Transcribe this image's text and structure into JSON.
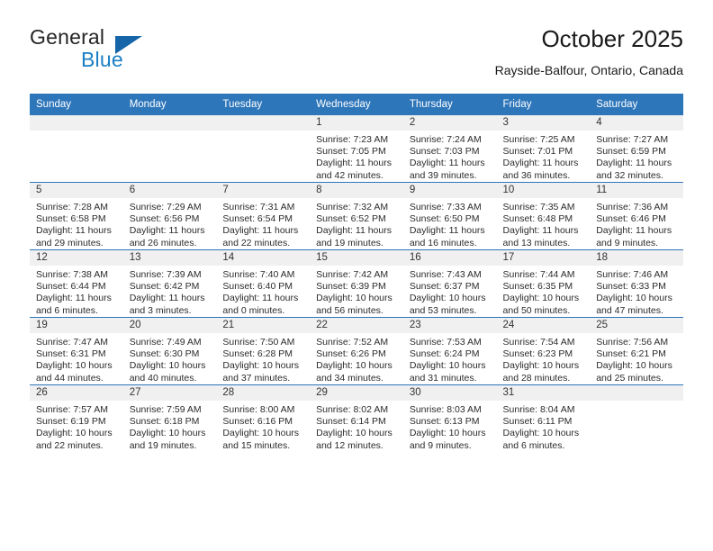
{
  "brand": {
    "name_line1": "General",
    "name_line2": "Blue",
    "logo_icon": "triangle-flag-icon",
    "color_primary": "#1b7fc4",
    "color_triangle": "#1565a8"
  },
  "header": {
    "title": "October 2025",
    "subtitle": "Rayside-Balfour, Ontario, Canada"
  },
  "theme": {
    "header_row_bg": "#2e76ba",
    "header_row_text": "#ffffff",
    "daynum_band_bg": "#f0f0f0",
    "cell_border": "#2e76ba"
  },
  "calendar": {
    "weekday_headers": [
      "Sunday",
      "Monday",
      "Tuesday",
      "Wednesday",
      "Thursday",
      "Friday",
      "Saturday"
    ],
    "weeks": [
      [
        {
          "day": "",
          "sunrise": "",
          "sunset": "",
          "daylight_line1": "",
          "daylight_line2": ""
        },
        {
          "day": "",
          "sunrise": "",
          "sunset": "",
          "daylight_line1": "",
          "daylight_line2": ""
        },
        {
          "day": "",
          "sunrise": "",
          "sunset": "",
          "daylight_line1": "",
          "daylight_line2": ""
        },
        {
          "day": "1",
          "sunrise": "Sunrise: 7:23 AM",
          "sunset": "Sunset: 7:05 PM",
          "daylight_line1": "Daylight: 11 hours",
          "daylight_line2": "and 42 minutes."
        },
        {
          "day": "2",
          "sunrise": "Sunrise: 7:24 AM",
          "sunset": "Sunset: 7:03 PM",
          "daylight_line1": "Daylight: 11 hours",
          "daylight_line2": "and 39 minutes."
        },
        {
          "day": "3",
          "sunrise": "Sunrise: 7:25 AM",
          "sunset": "Sunset: 7:01 PM",
          "daylight_line1": "Daylight: 11 hours",
          "daylight_line2": "and 36 minutes."
        },
        {
          "day": "4",
          "sunrise": "Sunrise: 7:27 AM",
          "sunset": "Sunset: 6:59 PM",
          "daylight_line1": "Daylight: 11 hours",
          "daylight_line2": "and 32 minutes."
        }
      ],
      [
        {
          "day": "5",
          "sunrise": "Sunrise: 7:28 AM",
          "sunset": "Sunset: 6:58 PM",
          "daylight_line1": "Daylight: 11 hours",
          "daylight_line2": "and 29 minutes."
        },
        {
          "day": "6",
          "sunrise": "Sunrise: 7:29 AM",
          "sunset": "Sunset: 6:56 PM",
          "daylight_line1": "Daylight: 11 hours",
          "daylight_line2": "and 26 minutes."
        },
        {
          "day": "7",
          "sunrise": "Sunrise: 7:31 AM",
          "sunset": "Sunset: 6:54 PM",
          "daylight_line1": "Daylight: 11 hours",
          "daylight_line2": "and 22 minutes."
        },
        {
          "day": "8",
          "sunrise": "Sunrise: 7:32 AM",
          "sunset": "Sunset: 6:52 PM",
          "daylight_line1": "Daylight: 11 hours",
          "daylight_line2": "and 19 minutes."
        },
        {
          "day": "9",
          "sunrise": "Sunrise: 7:33 AM",
          "sunset": "Sunset: 6:50 PM",
          "daylight_line1": "Daylight: 11 hours",
          "daylight_line2": "and 16 minutes."
        },
        {
          "day": "10",
          "sunrise": "Sunrise: 7:35 AM",
          "sunset": "Sunset: 6:48 PM",
          "daylight_line1": "Daylight: 11 hours",
          "daylight_line2": "and 13 minutes."
        },
        {
          "day": "11",
          "sunrise": "Sunrise: 7:36 AM",
          "sunset": "Sunset: 6:46 PM",
          "daylight_line1": "Daylight: 11 hours",
          "daylight_line2": "and 9 minutes."
        }
      ],
      [
        {
          "day": "12",
          "sunrise": "Sunrise: 7:38 AM",
          "sunset": "Sunset: 6:44 PM",
          "daylight_line1": "Daylight: 11 hours",
          "daylight_line2": "and 6 minutes."
        },
        {
          "day": "13",
          "sunrise": "Sunrise: 7:39 AM",
          "sunset": "Sunset: 6:42 PM",
          "daylight_line1": "Daylight: 11 hours",
          "daylight_line2": "and 3 minutes."
        },
        {
          "day": "14",
          "sunrise": "Sunrise: 7:40 AM",
          "sunset": "Sunset: 6:40 PM",
          "daylight_line1": "Daylight: 11 hours",
          "daylight_line2": "and 0 minutes."
        },
        {
          "day": "15",
          "sunrise": "Sunrise: 7:42 AM",
          "sunset": "Sunset: 6:39 PM",
          "daylight_line1": "Daylight: 10 hours",
          "daylight_line2": "and 56 minutes."
        },
        {
          "day": "16",
          "sunrise": "Sunrise: 7:43 AM",
          "sunset": "Sunset: 6:37 PM",
          "daylight_line1": "Daylight: 10 hours",
          "daylight_line2": "and 53 minutes."
        },
        {
          "day": "17",
          "sunrise": "Sunrise: 7:44 AM",
          "sunset": "Sunset: 6:35 PM",
          "daylight_line1": "Daylight: 10 hours",
          "daylight_line2": "and 50 minutes."
        },
        {
          "day": "18",
          "sunrise": "Sunrise: 7:46 AM",
          "sunset": "Sunset: 6:33 PM",
          "daylight_line1": "Daylight: 10 hours",
          "daylight_line2": "and 47 minutes."
        }
      ],
      [
        {
          "day": "19",
          "sunrise": "Sunrise: 7:47 AM",
          "sunset": "Sunset: 6:31 PM",
          "daylight_line1": "Daylight: 10 hours",
          "daylight_line2": "and 44 minutes."
        },
        {
          "day": "20",
          "sunrise": "Sunrise: 7:49 AM",
          "sunset": "Sunset: 6:30 PM",
          "daylight_line1": "Daylight: 10 hours",
          "daylight_line2": "and 40 minutes."
        },
        {
          "day": "21",
          "sunrise": "Sunrise: 7:50 AM",
          "sunset": "Sunset: 6:28 PM",
          "daylight_line1": "Daylight: 10 hours",
          "daylight_line2": "and 37 minutes."
        },
        {
          "day": "22",
          "sunrise": "Sunrise: 7:52 AM",
          "sunset": "Sunset: 6:26 PM",
          "daylight_line1": "Daylight: 10 hours",
          "daylight_line2": "and 34 minutes."
        },
        {
          "day": "23",
          "sunrise": "Sunrise: 7:53 AM",
          "sunset": "Sunset: 6:24 PM",
          "daylight_line1": "Daylight: 10 hours",
          "daylight_line2": "and 31 minutes."
        },
        {
          "day": "24",
          "sunrise": "Sunrise: 7:54 AM",
          "sunset": "Sunset: 6:23 PM",
          "daylight_line1": "Daylight: 10 hours",
          "daylight_line2": "and 28 minutes."
        },
        {
          "day": "25",
          "sunrise": "Sunrise: 7:56 AM",
          "sunset": "Sunset: 6:21 PM",
          "daylight_line1": "Daylight: 10 hours",
          "daylight_line2": "and 25 minutes."
        }
      ],
      [
        {
          "day": "26",
          "sunrise": "Sunrise: 7:57 AM",
          "sunset": "Sunset: 6:19 PM",
          "daylight_line1": "Daylight: 10 hours",
          "daylight_line2": "and 22 minutes."
        },
        {
          "day": "27",
          "sunrise": "Sunrise: 7:59 AM",
          "sunset": "Sunset: 6:18 PM",
          "daylight_line1": "Daylight: 10 hours",
          "daylight_line2": "and 19 minutes."
        },
        {
          "day": "28",
          "sunrise": "Sunrise: 8:00 AM",
          "sunset": "Sunset: 6:16 PM",
          "daylight_line1": "Daylight: 10 hours",
          "daylight_line2": "and 15 minutes."
        },
        {
          "day": "29",
          "sunrise": "Sunrise: 8:02 AM",
          "sunset": "Sunset: 6:14 PM",
          "daylight_line1": "Daylight: 10 hours",
          "daylight_line2": "and 12 minutes."
        },
        {
          "day": "30",
          "sunrise": "Sunrise: 8:03 AM",
          "sunset": "Sunset: 6:13 PM",
          "daylight_line1": "Daylight: 10 hours",
          "daylight_line2": "and 9 minutes."
        },
        {
          "day": "31",
          "sunrise": "Sunrise: 8:04 AM",
          "sunset": "Sunset: 6:11 PM",
          "daylight_line1": "Daylight: 10 hours",
          "daylight_line2": "and 6 minutes."
        },
        {
          "day": "",
          "sunrise": "",
          "sunset": "",
          "daylight_line1": "",
          "daylight_line2": ""
        }
      ]
    ]
  }
}
